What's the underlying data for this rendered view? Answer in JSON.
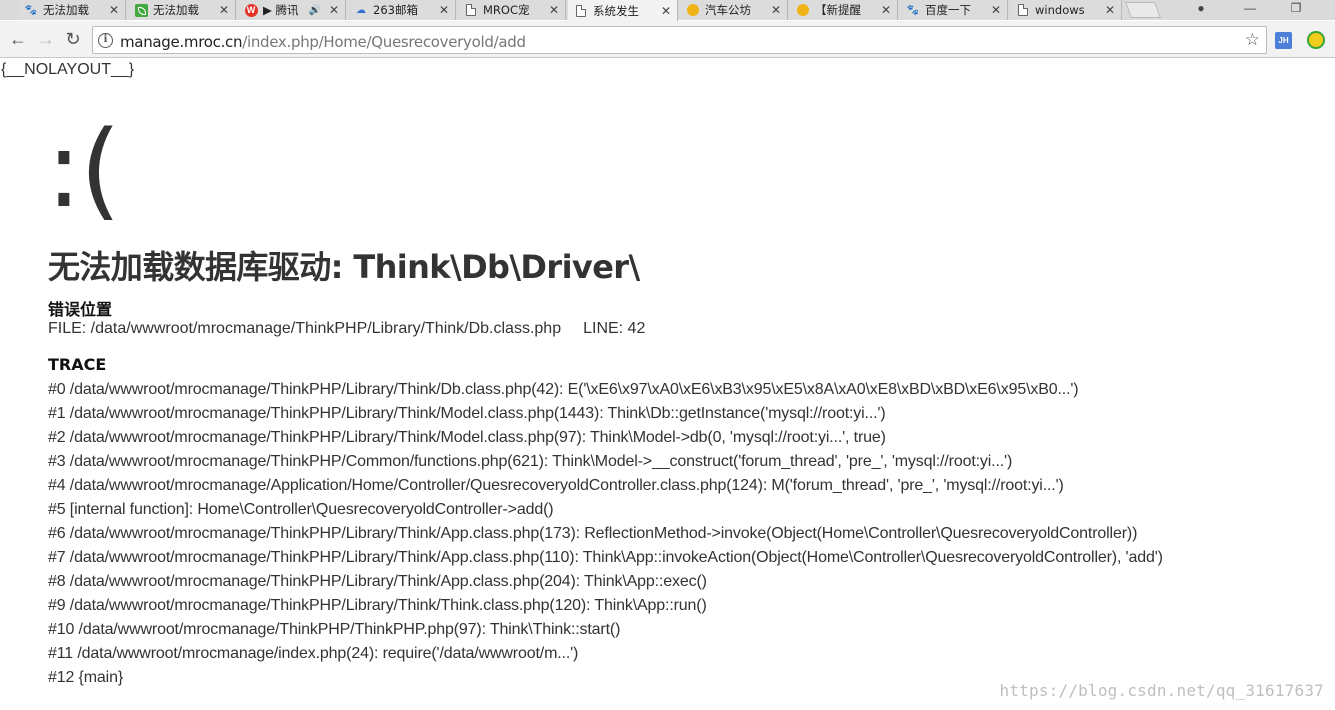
{
  "browser": {
    "tabs": [
      {
        "label": "无法加载",
        "icon": "paw-icon"
      },
      {
        "label": "无法加载",
        "icon": "leaf-icon"
      },
      {
        "label": "▶ 腾讯",
        "icon": "weibo-icon",
        "audio": "🔊"
      },
      {
        "label": "263邮箱",
        "icon": "cloud-icon"
      },
      {
        "label": "MROC宠",
        "icon": "document-icon"
      },
      {
        "label": "系统发生",
        "icon": "document-icon",
        "active": true
      },
      {
        "label": "汽车公坊",
        "icon": "sun-icon"
      },
      {
        "label": "【新提醒",
        "icon": "sun-icon"
      },
      {
        "label": "百度一下",
        "icon": "paw-icon"
      },
      {
        "label": "windows",
        "icon": "document-icon"
      }
    ],
    "close_glyph": "✕",
    "window_buttons": {
      "profile": "●",
      "minimize": "—",
      "restore": "❐"
    },
    "nav": {
      "back": "←",
      "forward": "→",
      "reload": "↻"
    },
    "url_host": "manage.mroc.cn",
    "url_path": "/index.php/Home/Quesrecoveryold/add",
    "bookmark_glyph": "☆",
    "info_glyph": "i",
    "extension_label": "JH"
  },
  "page": {
    "nolayout": "{__NOLAYOUT__}",
    "face": ":(",
    "error_title": "无法加载数据库驱动: Think\\Db\\Driver\\",
    "location_heading": "错误位置",
    "file_label": "FILE: /data/wwwroot/mrocmanage/ThinkPHP/Library/Think/Db.class.php",
    "line_label": "LINE: 42",
    "trace_heading": "TRACE",
    "trace": [
      "#0 /data/wwwroot/mrocmanage/ThinkPHP/Library/Think/Db.class.php(42): E('\\xE6\\x97\\xA0\\xE6\\xB3\\x95\\xE5\\x8A\\xA0\\xE8\\xBD\\xBD\\xE6\\x95\\xB0...')",
      "#1 /data/wwwroot/mrocmanage/ThinkPHP/Library/Think/Model.class.php(1443): Think\\Db::getInstance('mysql://root:yi...')",
      "#2 /data/wwwroot/mrocmanage/ThinkPHP/Library/Think/Model.class.php(97): Think\\Model->db(0, 'mysql://root:yi...', true)",
      "#3 /data/wwwroot/mrocmanage/ThinkPHP/Common/functions.php(621): Think\\Model->__construct('forum_thread', 'pre_', 'mysql://root:yi...')",
      "#4 /data/wwwroot/mrocmanage/Application/Home/Controller/QuesrecoveryoldController.class.php(124): M('forum_thread', 'pre_', 'mysql://root:yi...')",
      "#5 [internal function]: Home\\Controller\\QuesrecoveryoldController->add()",
      "#6 /data/wwwroot/mrocmanage/ThinkPHP/Library/Think/App.class.php(173): ReflectionMethod->invoke(Object(Home\\Controller\\QuesrecoveryoldController))",
      "#7 /data/wwwroot/mrocmanage/ThinkPHP/Library/Think/App.class.php(110): Think\\App::invokeAction(Object(Home\\Controller\\QuesrecoveryoldController), 'add')",
      "#8 /data/wwwroot/mrocmanage/ThinkPHP/Library/Think/App.class.php(204): Think\\App::exec()",
      "#9 /data/wwwroot/mrocmanage/ThinkPHP/Library/Think/Think.class.php(120): Think\\App::run()",
      "#10 /data/wwwroot/mrocmanage/ThinkPHP/ThinkPHP.php(97): Think\\Think::start()",
      "#11 /data/wwwroot/mrocmanage/index.php(24): require('/data/wwwroot/m...')",
      "#12 {main}"
    ],
    "watermark": "https://blog.csdn.net/qq_31617637"
  }
}
